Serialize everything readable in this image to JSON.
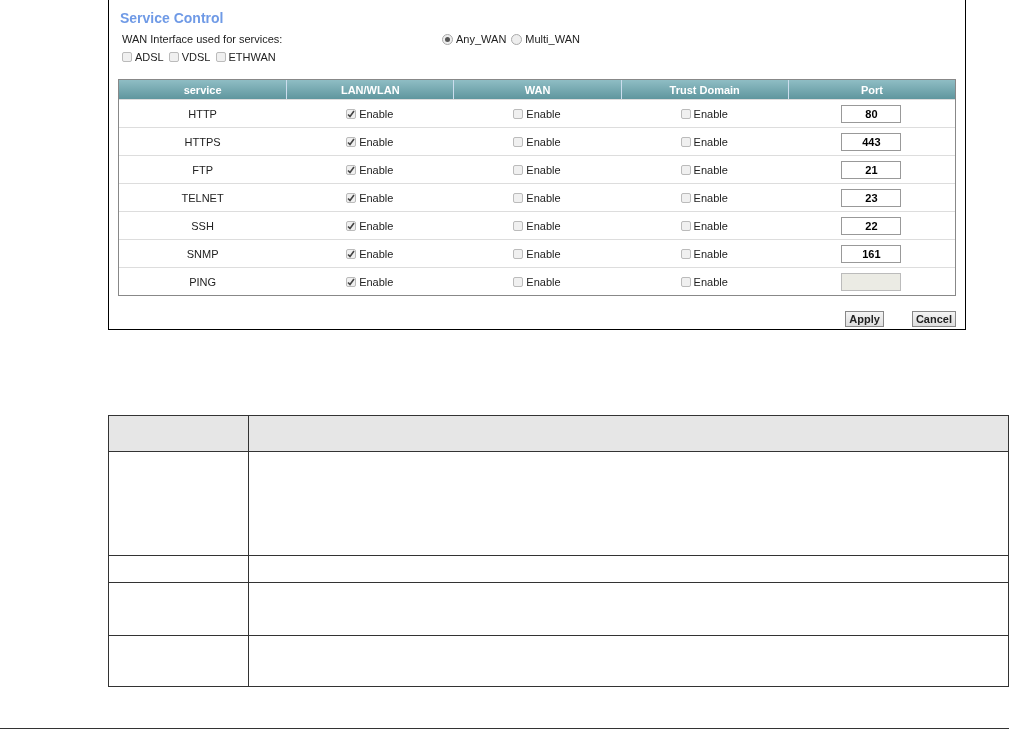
{
  "panel": {
    "title": "Service Control",
    "wan_label": "WAN Interface used for services:",
    "wan_options": [
      {
        "label": "Any_WAN",
        "selected": true
      },
      {
        "label": "Multi_WAN",
        "selected": false
      }
    ],
    "interfaces": [
      {
        "label": "ADSL",
        "checked": false
      },
      {
        "label": "VDSL",
        "checked": false
      },
      {
        "label": "ETHWAN",
        "checked": false
      }
    ],
    "table": {
      "columns": [
        "service",
        "LAN/WLAN",
        "WAN",
        "Trust Domain",
        "Port"
      ],
      "rows": [
        {
          "service": "HTTP",
          "lan": {
            "label": "Enable",
            "checked": true
          },
          "wan": {
            "label": "Enable",
            "checked": false
          },
          "trust": {
            "label": "Enable",
            "checked": false
          },
          "port": {
            "value": "80",
            "disabled": false
          }
        },
        {
          "service": "HTTPS",
          "lan": {
            "label": "Enable",
            "checked": true
          },
          "wan": {
            "label": "Enable",
            "checked": false
          },
          "trust": {
            "label": "Enable",
            "checked": false
          },
          "port": {
            "value": "443",
            "disabled": false
          }
        },
        {
          "service": "FTP",
          "lan": {
            "label": "Enable",
            "checked": true
          },
          "wan": {
            "label": "Enable",
            "checked": false
          },
          "trust": {
            "label": "Enable",
            "checked": false
          },
          "port": {
            "value": "21",
            "disabled": false
          }
        },
        {
          "service": "TELNET",
          "lan": {
            "label": "Enable",
            "checked": true
          },
          "wan": {
            "label": "Enable",
            "checked": false
          },
          "trust": {
            "label": "Enable",
            "checked": false
          },
          "port": {
            "value": "23",
            "disabled": false
          }
        },
        {
          "service": "SSH",
          "lan": {
            "label": "Enable",
            "checked": true
          },
          "wan": {
            "label": "Enable",
            "checked": false
          },
          "trust": {
            "label": "Enable",
            "checked": false
          },
          "port": {
            "value": "22",
            "disabled": false
          }
        },
        {
          "service": "SNMP",
          "lan": {
            "label": "Enable",
            "checked": true
          },
          "wan": {
            "label": "Enable",
            "checked": false
          },
          "trust": {
            "label": "Enable",
            "checked": false
          },
          "port": {
            "value": "161",
            "disabled": false
          }
        },
        {
          "service": "PING",
          "lan": {
            "label": "Enable",
            "checked": true
          },
          "wan": {
            "label": "Enable",
            "checked": false
          },
          "trust": {
            "label": "Enable",
            "checked": false
          },
          "port": {
            "disabled": true
          }
        }
      ]
    },
    "buttons": [
      "Apply",
      "Cancel"
    ]
  }
}
